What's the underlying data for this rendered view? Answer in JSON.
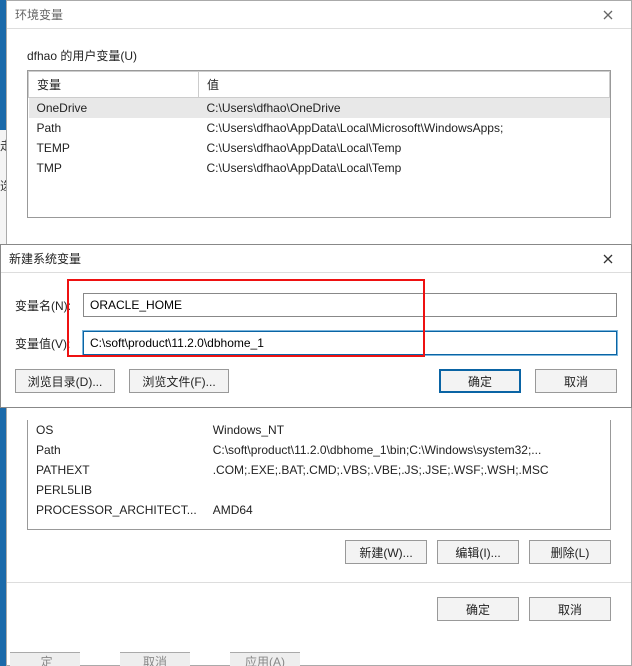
{
  "env_window": {
    "title": "环境变量",
    "user_section_label": "dfhao 的用户变量(U)",
    "columns": {
      "variable": "变量",
      "value": "值"
    },
    "user_vars": [
      {
        "name": "OneDrive",
        "value": "C:\\Users\\dfhao\\OneDrive",
        "selected": true
      },
      {
        "name": "Path",
        "value": "C:\\Users\\dfhao\\AppData\\Local\\Microsoft\\WindowsApps;"
      },
      {
        "name": "TEMP",
        "value": "C:\\Users\\dfhao\\AppData\\Local\\Temp"
      },
      {
        "name": "TMP",
        "value": "C:\\Users\\dfhao\\AppData\\Local\\Temp"
      }
    ],
    "system_vars": [
      {
        "name": "OS",
        "value": "Windows_NT"
      },
      {
        "name": "Path",
        "value": "C:\\soft\\product\\11.2.0\\dbhome_1\\bin;C:\\Windows\\system32;..."
      },
      {
        "name": "PATHEXT",
        "value": ".COM;.EXE;.BAT;.CMD;.VBS;.VBE;.JS;.JSE;.WSF;.WSH;.MSC"
      },
      {
        "name": "PERL5LIB",
        "value": ""
      },
      {
        "name": "PROCESSOR_ARCHITECT...",
        "value": "AMD64"
      }
    ],
    "buttons": {
      "new": "新建(W)...",
      "edit": "编辑(I)...",
      "delete": "删除(L)",
      "ok": "确定",
      "cancel": "取消"
    }
  },
  "newvar_dialog": {
    "title": "新建系统变量",
    "name_label": "变量名(N):",
    "value_label": "变量值(V):",
    "name_value": "ORACLE_HOME",
    "value_value": "C:\\soft\\product\\11.2.0\\dbhome_1",
    "browse_dir": "浏览目录(D)...",
    "browse_file": "浏览文件(F)...",
    "ok": "确定",
    "cancel": "取消"
  },
  "left_sliver": {
    "t1": "走",
    "t2": "选"
  },
  "bottom_partial": {
    "b1": " 定",
    "b2": "取消",
    "b3": "应用(A)"
  }
}
